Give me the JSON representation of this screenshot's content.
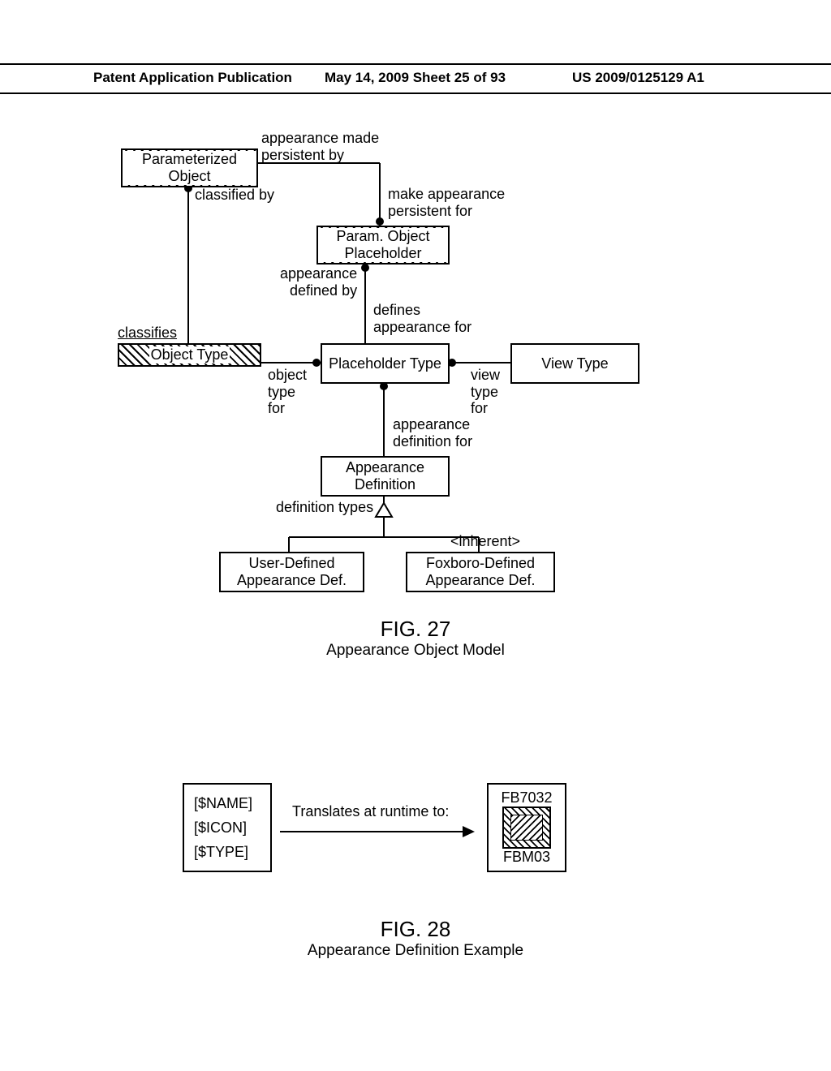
{
  "header": {
    "left": "Patent Application Publication",
    "center": "May 14, 2009  Sheet 25 of 93",
    "right": "US 2009/0125129 A1"
  },
  "fig27": {
    "boxes": {
      "paramObj": "Parameterized\nObject",
      "paramPlaceholder": "Param. Object\nPlaceholder",
      "objectType": "Object Type",
      "placeholderType": "Placeholder\nType",
      "viewType": "View Type",
      "appearanceDef": "Appearance\nDefinition",
      "userDef": "User-Defined\nAppearance Def.",
      "foxboroDef": "Foxboro-Defined\nAppearance Def."
    },
    "labels": {
      "appMadeBy": "appearance made\npersistent by",
      "makeAppFor": "make appearance\npersistent for",
      "classifiedBy": "classified by",
      "classifies": "classifies",
      "appDefBy": "appearance\ndefined by",
      "definesAppFor": "defines\nappearance for",
      "objectTypeFor": "object\ntype\nfor",
      "viewTypeFor": "view\ntype\nfor",
      "appDefFor": "appearance\ndefinition for",
      "defTypes": "definition types",
      "inherent": "<inherent>"
    },
    "caption": {
      "title": "FIG. 27",
      "subtitle": "Appearance Object Model"
    }
  },
  "fig28": {
    "template": {
      "name": "[$NAME]",
      "icon": "[$ICON]",
      "type": "[$TYPE]"
    },
    "arrowLabel": "Translates at runtime to:",
    "result": {
      "name": "FB7032",
      "type": "FBM03"
    },
    "caption": {
      "title": "FIG. 28",
      "subtitle": "Appearance Definition Example"
    }
  }
}
